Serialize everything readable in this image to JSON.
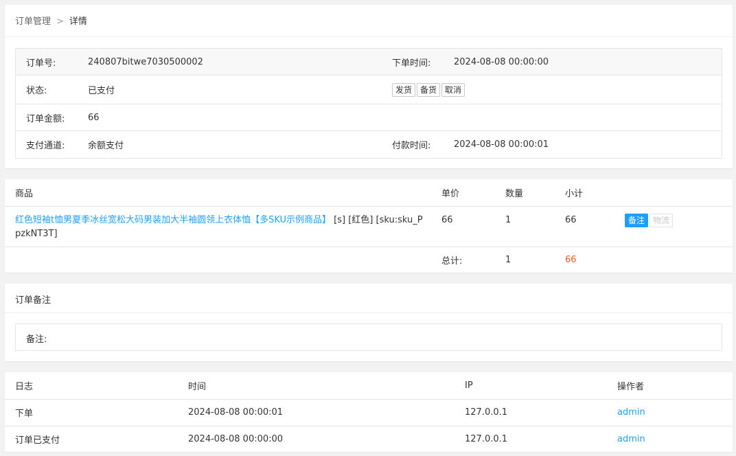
{
  "breadcrumb": {
    "parent": "订单管理",
    "separator": ">",
    "current": "详情"
  },
  "order": {
    "no_label": "订单号:",
    "no_value": "240807bitwe7030500002",
    "time_label": "下单时间:",
    "time_value": "2024-08-08 00:00:00",
    "status_label": "状态:",
    "status_value": "已支付",
    "actions": {
      "ship": "发货",
      "prepare": "备货",
      "cancel": "取消"
    },
    "amount_label": "订单金额:",
    "amount_value": "66",
    "channel_label": "支付通道:",
    "channel_value": "余额支付",
    "paytime_label": "付款时间:",
    "paytime_value": "2024-08-08 00:00:01"
  },
  "goods": {
    "headers": {
      "name": "商品",
      "price": "单价",
      "qty": "数量",
      "subtotal": "小计"
    },
    "item": {
      "name": "红色短袖t恤男夏季冰丝宽松大码男装加大半袖圆领上衣体恤【多SKU示例商品】",
      "spec": " [s] [红色] [sku:sku_PpzkNT3T]",
      "price": "66",
      "qty": "1",
      "subtotal": "66",
      "remark_btn": "备注",
      "logistics_btn": "物流"
    },
    "total_label": "总计:",
    "total_qty": "1",
    "total_amount": "66"
  },
  "remark": {
    "title": "订单备注",
    "label": "备注:"
  },
  "log": {
    "headers": {
      "log": "日志",
      "time": "时间",
      "ip": "IP",
      "operator": "操作者"
    },
    "rows": [
      {
        "log": "下单",
        "time": "2024-08-08 00:00:01",
        "ip": "127.0.0.1",
        "operator": "admin"
      },
      {
        "log": "订单已支付",
        "time": "2024-08-08 00:00:00",
        "ip": "127.0.0.1",
        "operator": "admin"
      }
    ]
  },
  "colors": {
    "link": "#1e9fff",
    "primary": "#1e9fff",
    "total": "#ff5722",
    "background": "#f2f2f2"
  }
}
